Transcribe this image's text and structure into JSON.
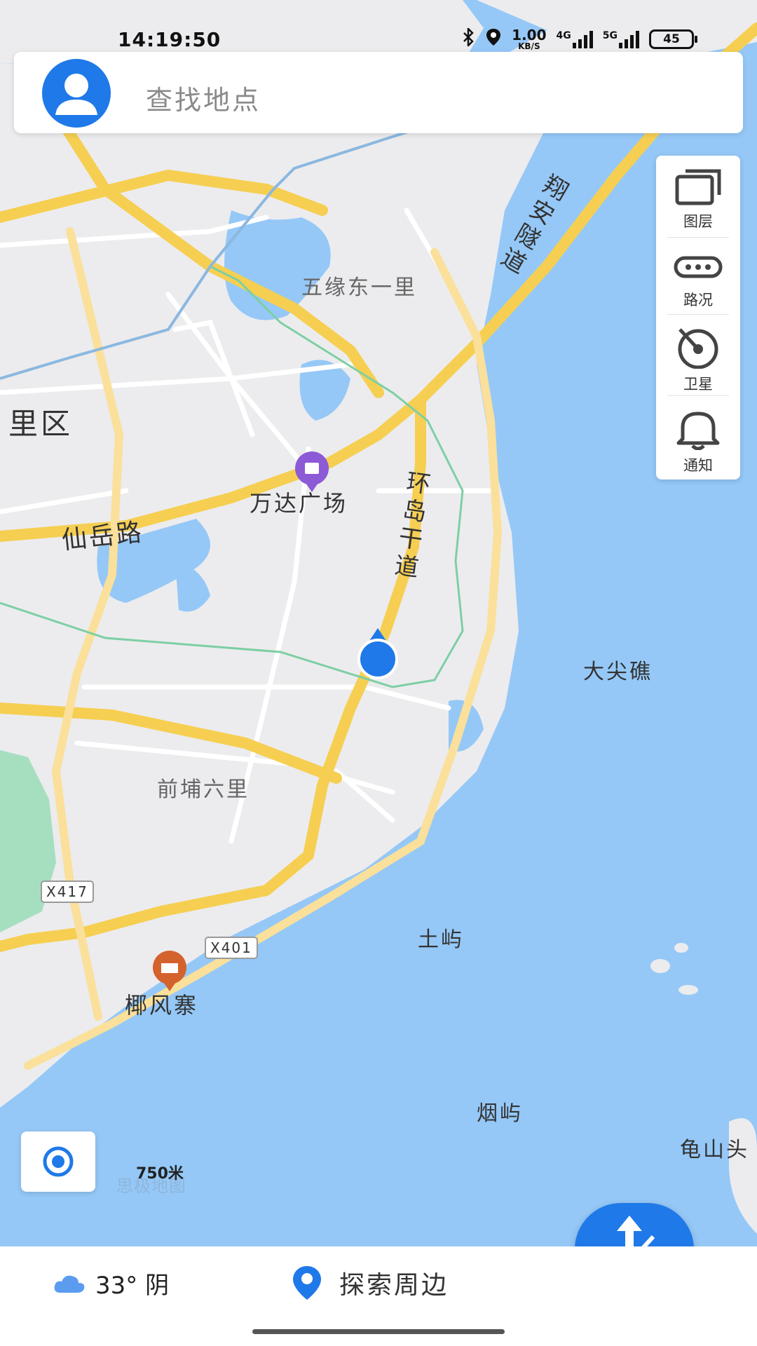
{
  "status_bar": {
    "time": "14:19:50",
    "net_speed": "1.00",
    "net_unit": "KB/S",
    "sig1": "4G",
    "sig2": "5G",
    "battery": "45"
  },
  "search": {
    "placeholder": "查找地点"
  },
  "tools": [
    {
      "label": "图层",
      "icon": "layers-icon"
    },
    {
      "label": "路况",
      "icon": "traffic-icon"
    },
    {
      "label": "卫星",
      "icon": "satellite-icon"
    },
    {
      "label": "通知",
      "icon": "bell-icon"
    }
  ],
  "map": {
    "labels": {
      "district": "里区",
      "wuyuan": "五缘东一里",
      "wanda": "万达广场",
      "xianyue": "仙岳路",
      "huandao": "环岛干道",
      "xiangan": "翔安隧道",
      "dajian": "大尖礁",
      "qianpu": "前埔六里",
      "tuyu": "土屿",
      "yefeng": "椰风寨",
      "yanyu": "烟屿",
      "guishan": "龟山头"
    },
    "shields": {
      "x417": "X417",
      "x401": "X401"
    },
    "scale": "750米",
    "brand": "思极地图"
  },
  "bottom": {
    "weather": "33° 阴",
    "explore": "探索周边",
    "route": "路线"
  },
  "colors": {
    "accent": "#1f79e8",
    "water": "#95c8f7",
    "land": "#ececee",
    "road": "#f6cf52"
  }
}
